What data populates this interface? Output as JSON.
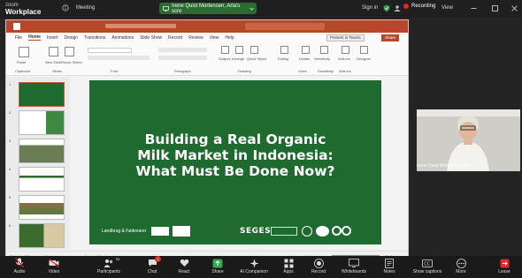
{
  "zoom": {
    "logo_small": "zoom",
    "logo_big": "Workplace",
    "topic": "Meeting",
    "share_label": "Irene Quist Mortensen, Arla's scre",
    "sign_in": "Sign in",
    "recording": "Recording",
    "view": "View"
  },
  "ppt": {
    "menu": [
      "File",
      "Home",
      "Insert",
      "Design",
      "Transitions",
      "Animations",
      "Slide Show",
      "Record",
      "Review",
      "View",
      "Help"
    ],
    "present_in_teams": "Present in Teams",
    "share": "Share",
    "ribbon": {
      "paste": "Paste",
      "new_slide": "New Slide",
      "reuse_slides": "Reuse Slides",
      "shapes": "Shapes",
      "arrange": "Arrange",
      "quick_styles": "Quick Styles",
      "editing": "Editing",
      "dictate": "Dictate",
      "sensitivity": "Sensitivity",
      "add_ins": "Add-ins",
      "designer": "Designer"
    },
    "ribbon_groups": [
      "Clipboard",
      "Slides",
      "Font",
      "Paragraph",
      "Drawing",
      "Voice",
      "Sensitivity",
      "Add-ins"
    ],
    "thumb_numbers": [
      "1",
      "2",
      "3",
      "4",
      "5",
      "6"
    ],
    "slide": {
      "title_line1": "Building a Real Organic",
      "title_line2": "Milk Market in Indonesia:",
      "title_line3": "What Must Be Done Now?",
      "landbrug": "Landbrug & Fødevarer",
      "seges": "SEGES"
    },
    "status": {
      "slide_info": "Slide 1 of 28",
      "language": "Danish",
      "accessibility": "Accessibility: Investigate",
      "notes": "Notes",
      "zoom": "74 %"
    }
  },
  "participant": {
    "name": "Irene Quist Mortensen, Arla"
  },
  "toolbar": {
    "audio": "Audio",
    "video": "Video",
    "participants": "Participants",
    "participants_count": "91",
    "chat": "Chat",
    "chat_count": "1",
    "react": "React",
    "share": "Share",
    "ai_companion": "AI Companion",
    "apps": "Apps",
    "record": "Record",
    "whiteboards": "Whiteboards",
    "notes": "Notes",
    "show_captions": "Show captions",
    "more": "More",
    "leave": "Leave"
  },
  "colors": {
    "ppt_accent": "#b7472a",
    "slide_bg": "#1f6b2f",
    "share_green": "#2a6b2f",
    "recording_red": "#e02828",
    "leave_red": "#e02828"
  }
}
